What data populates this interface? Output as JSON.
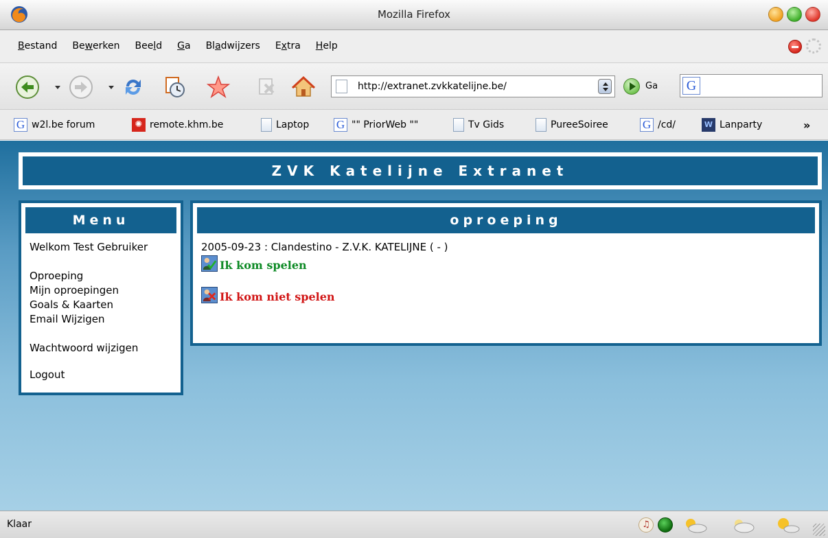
{
  "window": {
    "title": "Mozilla Firefox"
  },
  "menubar": {
    "items": [
      {
        "pre": "",
        "key": "B",
        "post": "estand"
      },
      {
        "pre": "Be",
        "key": "w",
        "post": "erken"
      },
      {
        "pre": "Bee",
        "key": "l",
        "post": "d"
      },
      {
        "pre": "",
        "key": "G",
        "post": "a"
      },
      {
        "pre": "Bl",
        "key": "a",
        "post": "dwijzers"
      },
      {
        "pre": "E",
        "key": "x",
        "post": "tra"
      },
      {
        "pre": "",
        "key": "H",
        "post": "elp"
      }
    ]
  },
  "navbar": {
    "url": "http://extranet.zvkkatelijne.be/",
    "go_label": "Ga",
    "search_value": ""
  },
  "bookmarks": [
    {
      "label": "w2l.be forum",
      "icon": "google-icon"
    },
    {
      "label": "remote.khm.be",
      "icon": "remote-icon"
    },
    {
      "label": "Laptop",
      "icon": "page-icon"
    },
    {
      "label": "\"\" PriorWeb \"\"",
      "icon": "google-icon"
    },
    {
      "label": "Tv Gids",
      "icon": "page-icon"
    },
    {
      "label": "PureeSoiree",
      "icon": "page-icon"
    },
    {
      "label": "/cd/",
      "icon": "google-icon"
    },
    {
      "label": "Lanparty",
      "icon": "lanparty-icon"
    }
  ],
  "bookmarks_more": "»",
  "site": {
    "header": "ZVK Katelijne Extranet",
    "menu": {
      "title": "Menu",
      "welcome": "Welkom Test Gebruiker",
      "links": [
        "Oproeping",
        "Mijn oproepingen",
        "Goals & Kaarten",
        "Email Wijzigen"
      ],
      "password": "Wachtwoord wijzigen",
      "logout": "Logout"
    },
    "main": {
      "title": "oproeping",
      "call": "2005-09-23 : Clandestino - Z.V.K. KATELIJNE ( - )",
      "accept": "Ik kom spelen",
      "decline": "Ik kom niet spelen"
    }
  },
  "statusbar": {
    "text": "Klaar"
  },
  "colors": {
    "brand": "#13618f",
    "accept": "#0d8a25",
    "decline": "#d11414"
  }
}
